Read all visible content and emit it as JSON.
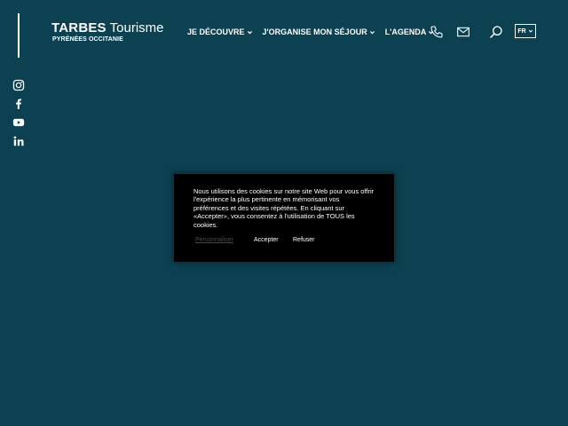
{
  "header": {
    "logo": {
      "title_bold": "TARBES",
      "title_regular": "Tourisme",
      "subtitle": "PYRÉNÉES OCCITANIE"
    },
    "nav": [
      {
        "label": "JE DÉCOUVRE"
      },
      {
        "label": "J'ORGANISE MON SÉJOUR"
      },
      {
        "label": "L'AGENDA"
      }
    ],
    "icons": {
      "phone": "phone-icon",
      "mail": "mail-icon",
      "search": "search-icon"
    },
    "language": {
      "selected": "FR"
    }
  },
  "social": [
    {
      "icon": "instagram-icon"
    },
    {
      "icon": "facebook-icon"
    },
    {
      "icon": "youtube-icon"
    },
    {
      "icon": "linkedin-icon"
    }
  ],
  "cookie_banner": {
    "message": "Nous utilisons des cookies sur notre site Web pour vous offrir l'expérience la plus pertinente en mémorisant vos préférences et des visites répétées. En cliquant sur «Accepter», vous consentez à l'utilisation de TOUS les cookies.",
    "customize_label": "Personnaliser",
    "accept_label": "Accepter",
    "refuse_label": "Refuser"
  },
  "colors": {
    "background": "#0b4150",
    "banner": "#000000",
    "text": "#ffffff",
    "muted_link": "#4a4a4a"
  }
}
